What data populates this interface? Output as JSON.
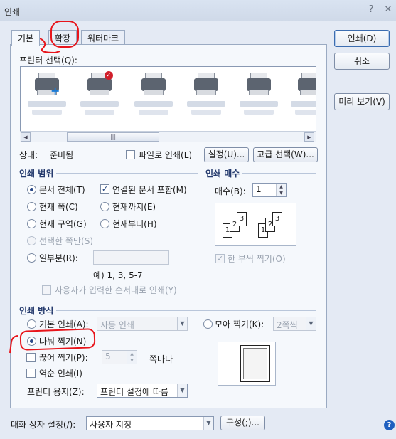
{
  "window": {
    "title": "인쇄",
    "help_glyph": "?",
    "close_glyph": "✕"
  },
  "tabs": [
    "기본",
    "확장",
    "워터마크"
  ],
  "side_buttons": {
    "print": "인쇄(D)",
    "cancel": "취소",
    "preview": "미리 보기(V)"
  },
  "printer_select": {
    "label": "프린터 선택(Q):",
    "status_label": "상태:",
    "status_value": "준비됨",
    "print_to_file": "파일로 인쇄(L)",
    "settings_button": "설정(U)...",
    "advanced_button": "고급 선택(W)..."
  },
  "print_range": {
    "title": "인쇄 범위",
    "all_docs": "문서 전체(T)",
    "include_linked": "연결된 문서 포함(M)",
    "current_page": "현재 쪽(C)",
    "to_current": "현재까지(E)",
    "current_section": "현재 구역(G)",
    "from_current": "현재부터(H)",
    "selected_pages": "선택한 쪽만(S)",
    "partial": "일부분(R):",
    "example": "예) 1, 3, 5-7",
    "user_order": "사용자가 입력한 순서대로 인쇄(Y)"
  },
  "copies": {
    "title": "인쇄 매수",
    "label": "매수(B):",
    "value": "1",
    "collate": "한 부씩 찍기(O)",
    "stack_pages": [
      "1",
      "2",
      "3"
    ]
  },
  "print_method": {
    "title": "인쇄 방식",
    "basic": "기본 인쇄(A):",
    "basic_value": "자동 인쇄",
    "collect": "모아 찍기(K):",
    "collect_value": "2쪽씩",
    "split": "나눠 찍기(N)",
    "tile": "끊어 찍기(P):",
    "tile_value": "5",
    "tile_unit": "쪽마다",
    "reverse": "역순 인쇄(I)",
    "paper_label": "프린터 용지(Z):",
    "paper_value": "프린터 설정에 따름"
  },
  "footer": {
    "dialog_label": "대화 상자 설정(/):",
    "dialog_value": "사용자 지정",
    "config_button": "구성(;)..."
  },
  "colors": {
    "annotation": "#e8151b",
    "accent": "#2b4a8a"
  }
}
